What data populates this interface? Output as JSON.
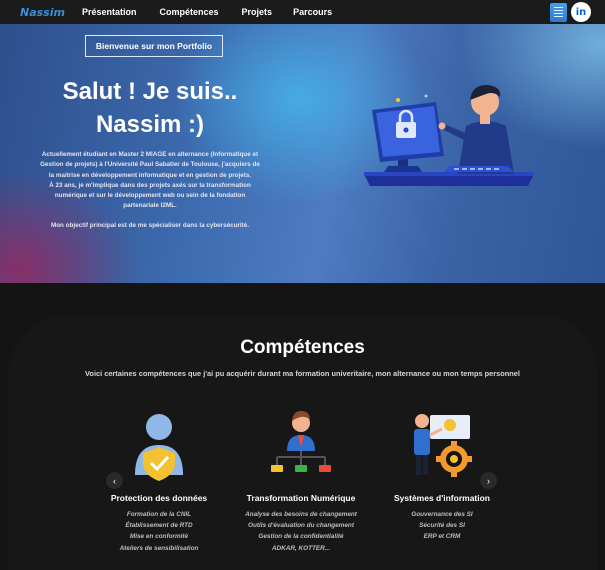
{
  "nav": {
    "brand": "Nassim",
    "links": [
      "Présentation",
      "Compétences",
      "Projets",
      "Parcours"
    ],
    "icons": [
      "cv-document-icon",
      "linkedin-icon"
    ],
    "linkedin_label": "in"
  },
  "hero": {
    "welcome": "Bienvenue sur mon Portfolio",
    "title_line1": "Salut ! Je suis..",
    "title_line2": "Nassim :)",
    "desc_lines": [
      "Actuellement étudiant en Master 2 MIAGE en alternance (Informatique et",
      "Gestion de projets) à l'Université Paul Sabatier de Toulouse, j'acquiers de",
      "la maitrise en développement informatique et en gestion de projets.",
      "À 23 ans, je m'implique dans des projets axés sur la transformation",
      "numérique et sur le développement web ou sein de la fondation",
      "partenariale I2ML."
    ],
    "goal": "Mon objectif principal est de me spécialiser dans la cybersécurité."
  },
  "competences": {
    "title": "Compétences",
    "subtitle": "Voici certaines compétences que j'ai pu acquérir durant ma formation univeritaire, mon alternance ou mon temps personnel",
    "cards": [
      {
        "title": "Protection des données",
        "icon": "shield-user-icon",
        "items": [
          "Formation de la CNIL",
          "Établissement de RTD",
          "Mise en conformité",
          "Ateliers de sensibilisation"
        ]
      },
      {
        "title": "Transformation Numérique",
        "icon": "org-chart-icon",
        "items": [
          "Analyse des besoins de changement",
          "Outils d'évaluation du changement",
          "Gestion de la confidentialité",
          "ADKAR, KOTTER..."
        ]
      },
      {
        "title": "Systèmes d'information",
        "icon": "gear-presenter-icon",
        "items": [
          "Gouvernance des SI",
          "Sécurité des SI",
          "ERP et CRM"
        ]
      }
    ],
    "prev": "‹",
    "next": "›"
  },
  "colors": {
    "brand": "#3a8fd8",
    "navbar": "#1b1b1b",
    "background": "#141414",
    "hero_blue": "#3d6cb0",
    "hero_magenta": "#962860"
  }
}
